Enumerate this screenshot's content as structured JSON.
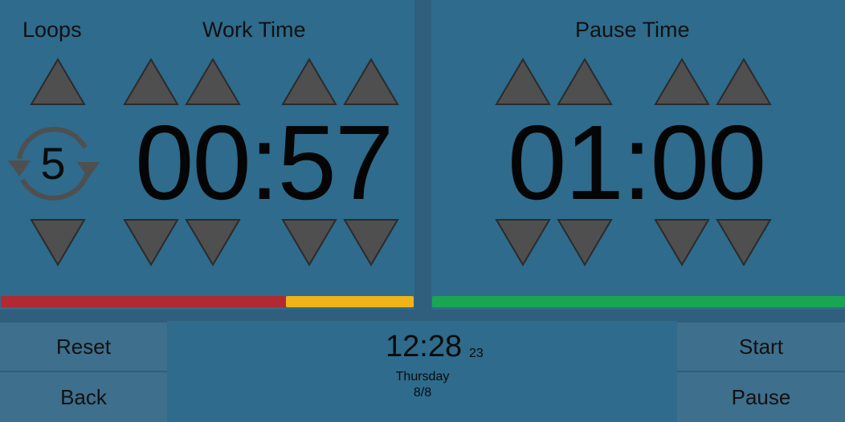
{
  "work": {
    "loops_label": "Loops",
    "title": "Work Time",
    "time": "00:57",
    "loops_count": "5",
    "progress": {
      "elapsed_fraction": 0.69,
      "colors": {
        "elapsed": "#b12a31",
        "remaining": "#f0b418"
      }
    }
  },
  "pause": {
    "title": "Pause Time",
    "time": "01:00",
    "progress": {
      "remaining_fraction": 1.0,
      "colors": {
        "remaining": "#19a651"
      }
    }
  },
  "controls": {
    "reset": "Reset",
    "back": "Back",
    "start": "Start",
    "pause": "Pause"
  },
  "clock": {
    "time": "12:28",
    "seconds": "23",
    "day": "Thursday",
    "date": "8/8"
  },
  "icons": {
    "up": "triangle-up-icon",
    "down": "triangle-down-icon",
    "loop": "repeat-icon"
  },
  "colors": {
    "panel": "#2e6b8c",
    "background": "#2f5f7d",
    "button": "#3e6f8c",
    "triangle": "#4f4f4f"
  }
}
